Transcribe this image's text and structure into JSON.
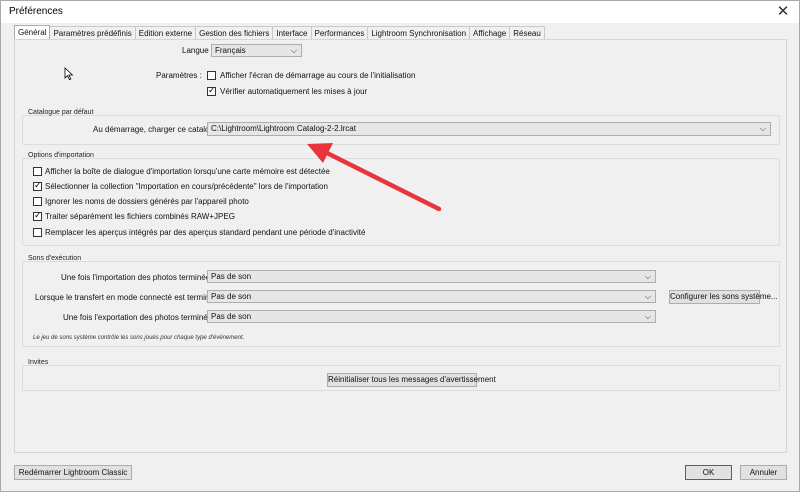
{
  "window": {
    "title": "Préférences",
    "close_glyph": "✕"
  },
  "tabs": [
    {
      "label": "Général",
      "active": true
    },
    {
      "label": "Paramètres prédéfinis"
    },
    {
      "label": "Edition externe"
    },
    {
      "label": "Gestion des fichiers"
    },
    {
      "label": "Interface"
    },
    {
      "label": "Performances"
    },
    {
      "label": "Lightroom Synchronisation"
    },
    {
      "label": "Affichage"
    },
    {
      "label": "Réseau"
    }
  ],
  "general": {
    "language_label": "Langue :",
    "language_value": "Français",
    "settings_label": "Paramètres :",
    "show_splash": {
      "label": "Afficher l'écran de démarrage au cours de l'initialisation",
      "checked": false
    },
    "check_updates": {
      "label": "Vérifier automatiquement les mises à jour",
      "checked": true
    }
  },
  "catalog": {
    "group_title": "Catalogue par défaut",
    "startup_label": "Au démarrage, charger ce catalogue :",
    "startup_value": "C:\\Lightroom\\Lightroom Catalog-2-2.lrcat"
  },
  "import": {
    "group_title": "Options d'importation",
    "options": [
      {
        "label": "Afficher la boîte de dialogue d'importation lorsqu'une carte mémoire est détectée",
        "checked": false
      },
      {
        "label": "Sélectionner la collection \"Importation en cours/précédente\" lors de l'importation",
        "checked": true
      },
      {
        "label": "Ignorer les noms de dossiers générés par l'appareil photo",
        "checked": false
      },
      {
        "label": "Traiter séparément les fichiers combinés RAW+JPEG",
        "checked": true
      },
      {
        "label": "Remplacer les aperçus intégrés par des aperçus standard pendant une période d'inactivité",
        "checked": false
      }
    ]
  },
  "sounds": {
    "group_title": "Sons d'exécution",
    "rows": [
      {
        "label": "Une fois l'importation des photos terminée, lire :",
        "value": "Pas de son"
      },
      {
        "label": "Lorsque le transfert en mode connecté est terminé, lire :",
        "value": "Pas de son"
      },
      {
        "label": "Une fois l'exportation des photos terminée, lire :",
        "value": "Pas de son"
      }
    ],
    "configure_button": "Configurer les sons système...",
    "note": "Le jeu de sons système contrôle les sons joués pour chaque type d'événement."
  },
  "prompts": {
    "group_title": "Invites",
    "reset_button": "Réinitialiser tous les messages d'avertissement"
  },
  "footer": {
    "restart_button": "Redémarrer Lightroom Classic",
    "ok_button": "OK",
    "cancel_button": "Annuler"
  },
  "icons": {
    "dropdown": "chevron-down-icon",
    "cursor": "mouse-cursor-icon",
    "annotation": "red-arrow-icon"
  },
  "colors": {
    "annotation_arrow": "#e8353a",
    "primary_border": "#0078d7"
  }
}
